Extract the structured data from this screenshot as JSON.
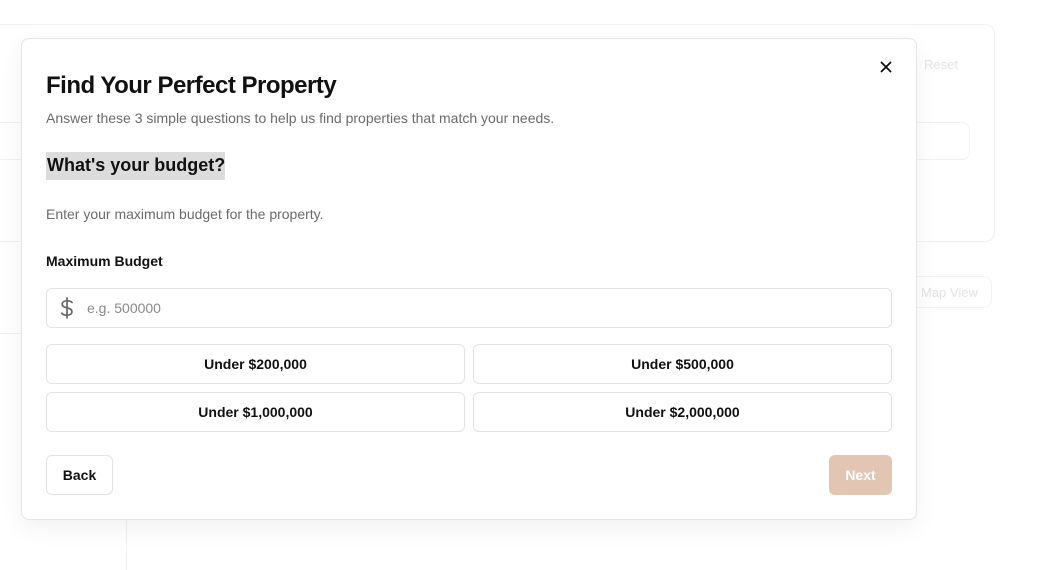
{
  "background": {
    "reset_label": "Reset",
    "map_view_label": "Map View"
  },
  "modal": {
    "title": "Find Your Perfect Property",
    "description": "Answer these 3 simple questions to help us find properties that match your needs.",
    "step": {
      "title": "What's your budget?",
      "description": "Enter your maximum budget for the property.",
      "field_label": "Maximum Budget",
      "input_value": "",
      "input_placeholder": "e.g. 500000",
      "input_icon": "dollar-icon",
      "presets": [
        "Under $200,000",
        "Under $500,000",
        "Under $1,000,000",
        "Under $2,000,000"
      ]
    },
    "back_label": "Back",
    "next_label": "Next",
    "next_disabled": true,
    "close_icon": "close-icon"
  },
  "colors": {
    "next_disabled_bg": "#e2c5b3",
    "highlight_bg": "#dcdcdc",
    "text_primary": "#111111",
    "text_muted": "#6b6b6b"
  }
}
